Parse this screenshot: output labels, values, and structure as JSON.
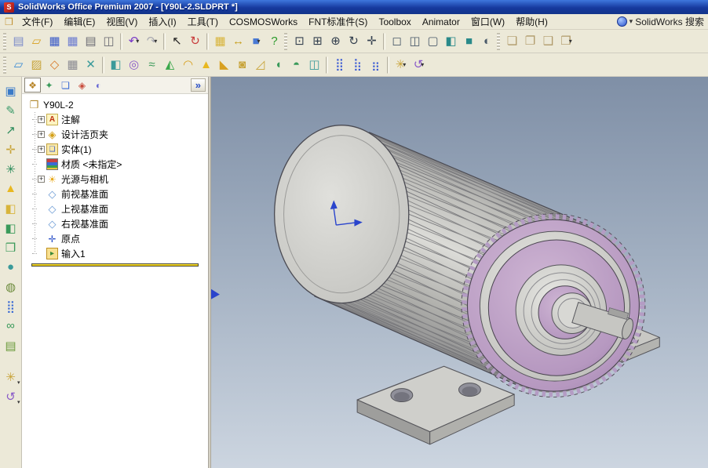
{
  "window": {
    "title": "SolidWorks Office Premium 2007 - [Y90L-2.SLDPRT *]"
  },
  "menubar": {
    "items": [
      {
        "name": "menu-file",
        "label": "文件(F)"
      },
      {
        "name": "menu-edit",
        "label": "编辑(E)"
      },
      {
        "name": "menu-view",
        "label": "视图(V)"
      },
      {
        "name": "menu-insert",
        "label": "插入(I)"
      },
      {
        "name": "menu-tools",
        "label": "工具(T)"
      },
      {
        "name": "menu-cosmosworks",
        "label": "COSMOSWorks"
      },
      {
        "name": "menu-fnt-standard-parts",
        "label": "FNT标准件(S)"
      },
      {
        "name": "menu-toolbox",
        "label": "Toolbox"
      },
      {
        "name": "menu-animator",
        "label": "Animator"
      },
      {
        "name": "menu-window",
        "label": "窗口(W)"
      },
      {
        "name": "menu-help",
        "label": "帮助(H)"
      }
    ],
    "search": {
      "label": "SolidWorks 搜索"
    }
  },
  "toolbar_standard": {
    "icons": [
      {
        "name": "toolbar-grip",
        "cls": "grip"
      },
      {
        "name": "new-file-icon",
        "glyph": "▤",
        "color": "#7a8ac8"
      },
      {
        "name": "open-file-icon",
        "glyph": "▱",
        "color": "#d8a020"
      },
      {
        "name": "save-icon",
        "glyph": "▦",
        "color": "#3a5ac8"
      },
      {
        "name": "save-all-icon",
        "glyph": "▦",
        "color": "#6a7ad0"
      },
      {
        "name": "print-icon",
        "glyph": "▤",
        "color": "#6a6a72"
      },
      {
        "name": "print-preview-icon",
        "glyph": "◫",
        "color": "#6a6a72"
      },
      {
        "name": "toolbar-separator",
        "cls": "sep"
      },
      {
        "name": "undo-icon",
        "glyph": "↶",
        "color": "#7a3ac8",
        "drop": true
      },
      {
        "name": "redo-icon",
        "glyph": "↷",
        "color": "#a8a8b0",
        "drop": true
      },
      {
        "name": "toolbar-separator",
        "cls": "sep"
      },
      {
        "name": "select-cursor-icon",
        "glyph": "↖",
        "color": "#222222"
      },
      {
        "name": "rebuild-icon",
        "glyph": "↻",
        "color": "#c83a3a"
      },
      {
        "name": "toolbar-separator",
        "cls": "sep"
      },
      {
        "name": "sketch-grid-icon",
        "glyph": "▦",
        "color": "#d8b43a"
      },
      {
        "name": "dimension-icon",
        "glyph": "↔",
        "color": "#c8a020"
      },
      {
        "name": "appearance-icon",
        "glyph": "■",
        "color": "#4a7ad4",
        "drop": true
      },
      {
        "name": "help-icon",
        "glyph": "?",
        "color": "#2a9a2a"
      },
      {
        "name": "toolbar-grip",
        "cls": "grip"
      },
      {
        "name": "zoom-to-fit-icon",
        "glyph": "⊡",
        "color": "#333f4e"
      },
      {
        "name": "zoom-area-icon",
        "glyph": "⊞",
        "color": "#333f4e"
      },
      {
        "name": "zoom-in-out-icon",
        "glyph": "⊕",
        "color": "#333f4e"
      },
      {
        "name": "rotate-view-icon",
        "glyph": "↻",
        "color": "#333f4e"
      },
      {
        "name": "pan-icon",
        "glyph": "✛",
        "color": "#333f4e"
      },
      {
        "name": "toolbar-separator",
        "cls": "sep"
      },
      {
        "name": "wireframe-icon",
        "glyph": "◻",
        "color": "#4a5a6a"
      },
      {
        "name": "hidden-lines-visible-icon",
        "glyph": "◫",
        "color": "#4a5a6a"
      },
      {
        "name": "hidden-lines-removed-icon",
        "glyph": "▢",
        "color": "#4a5a6a"
      },
      {
        "name": "shaded-with-edges-icon",
        "glyph": "◧",
        "color": "#2a8a8a"
      },
      {
        "name": "shaded-icon",
        "glyph": "■",
        "color": "#2a8a8a"
      },
      {
        "name": "section-view-icon",
        "glyph": "◐",
        "color": "#4a5a6a"
      },
      {
        "name": "toolbar-grip",
        "cls": "grip"
      },
      {
        "name": "view-orientation-cube-icon",
        "glyph": "❏",
        "color": "#b09a6a"
      },
      {
        "name": "view-cube-front-icon",
        "glyph": "❐",
        "color": "#b09a6a"
      },
      {
        "name": "view-cube-iso-icon",
        "glyph": "❑",
        "color": "#b09a6a"
      },
      {
        "name": "view-cube-dimetric-icon",
        "glyph": "❒",
        "color": "#b09a6a",
        "drop": true
      }
    ]
  },
  "toolbar_features": {
    "icons": [
      {
        "name": "toolbar-grip",
        "cls": "grip"
      },
      {
        "name": "reference-plane-icon",
        "glyph": "▱",
        "color": "#3a8ad4"
      },
      {
        "name": "sketch-tool-icon",
        "glyph": "▨",
        "color": "#c8a43a"
      },
      {
        "name": "convert-entities-icon",
        "glyph": "◇",
        "color": "#d87a2a"
      },
      {
        "name": "grid-icon",
        "glyph": "▦",
        "color": "#8a8a92"
      },
      {
        "name": "trim-icon",
        "glyph": "✕",
        "color": "#3a9a9a"
      },
      {
        "name": "toolbar-separator",
        "cls": "sep"
      },
      {
        "name": "extruded-boss-icon",
        "glyph": "◧",
        "color": "#3a9a9a"
      },
      {
        "name": "revolved-boss-icon",
        "glyph": "◎",
        "color": "#8a5ac8"
      },
      {
        "name": "swept-boss-icon",
        "glyph": "≈",
        "color": "#3a9a5a"
      },
      {
        "name": "lofted-boss-icon",
        "glyph": "◭",
        "color": "#3aa84a"
      },
      {
        "name": "fillet-icon",
        "glyph": "◠",
        "color": "#d8a020"
      },
      {
        "name": "bell-icon",
        "glyph": "▲",
        "color": "#e8b820"
      },
      {
        "name": "chamfer-icon",
        "glyph": "◣",
        "color": "#d8a020"
      },
      {
        "name": "shell-icon",
        "glyph": "◙",
        "color": "#c8a43a"
      },
      {
        "name": "draft-icon",
        "glyph": "◿",
        "color": "#c8a43a"
      },
      {
        "name": "wrap-icon",
        "glyph": "◖",
        "color": "#3a9a5a"
      },
      {
        "name": "dome-icon",
        "glyph": "◓",
        "color": "#3a9a5a"
      },
      {
        "name": "mirror-icon",
        "glyph": "◫",
        "color": "#3a9a9a"
      },
      {
        "name": "toolbar-separator",
        "cls": "sep"
      },
      {
        "name": "linear-pattern-icon",
        "glyph": "⣿",
        "color": "#3a5ad4"
      },
      {
        "name": "circular-pattern-icon",
        "glyph": "⣷",
        "color": "#3a5ad4"
      },
      {
        "name": "table-pattern-icon",
        "glyph": "⣶",
        "color": "#3a5ad4"
      },
      {
        "name": "toolbar-separator",
        "cls": "sep"
      },
      {
        "name": "reference-geometry-icon",
        "glyph": "✳",
        "color": "#c8a43a",
        "drop": true
      },
      {
        "name": "curves-icon",
        "glyph": "↺",
        "color": "#8a5ac8",
        "drop": true
      }
    ]
  },
  "left_toolbar": {
    "icons": [
      {
        "name": "viewport-screen-icon",
        "glyph": "▣",
        "color": "#3a7ac8"
      },
      {
        "name": "pencil-icon",
        "glyph": "✎",
        "color": "#3a9a6a"
      },
      {
        "name": "axis-arrow-icon",
        "glyph": "↗",
        "color": "#2a8a5a"
      },
      {
        "name": "coordinate-icon",
        "glyph": "✛",
        "color": "#c8a43a"
      },
      {
        "name": "note-icon",
        "glyph": "✳",
        "color": "#2a8a5a"
      },
      {
        "name": "bell-icon",
        "glyph": "▲",
        "color": "#e8b820"
      },
      {
        "name": "yellow-box-icon",
        "glyph": "◧",
        "color": "#d8b43a"
      },
      {
        "name": "green-box-icon",
        "glyph": "◧",
        "color": "#3a9a5a"
      },
      {
        "name": "cube-icon",
        "glyph": "❒",
        "color": "#3a9a5a"
      },
      {
        "name": "sphere-icon",
        "glyph": "●",
        "color": "#3a9a9a"
      },
      {
        "name": "disc-icon",
        "glyph": "◍",
        "color": "#6a8a3a"
      },
      {
        "name": "pattern-dots-icon",
        "glyph": "⣿",
        "color": "#3a6ad4"
      },
      {
        "name": "link-icon",
        "glyph": "∞",
        "color": "#3a9a5a"
      },
      {
        "name": "layers-icon",
        "glyph": "▤",
        "color": "#6a9a3a"
      },
      {
        "name": "star-burst-icon",
        "glyph": "✳",
        "color": "#c8a43a",
        "drop": true,
        "cls": "gap"
      },
      {
        "name": "spline-icon",
        "glyph": "↺",
        "color": "#8a5ac8",
        "drop": true
      }
    ]
  },
  "feature_panel": {
    "collapse_label": "»",
    "tabs": [
      {
        "name": "tab-featuremanager",
        "glyph": "❖",
        "color": "#b8862a",
        "cls": "active"
      },
      {
        "name": "tab-propertymanager",
        "glyph": "✦",
        "color": "#3a9a5a"
      },
      {
        "name": "tab-configurationmanager",
        "glyph": "❏",
        "color": "#3a6ad4"
      },
      {
        "name": "tab-cosmosworks",
        "glyph": "◈",
        "color": "#c84a3a"
      },
      {
        "name": "tab-display-pane",
        "glyph": "◐",
        "color": "#6a6ad4"
      }
    ],
    "tree": {
      "root": {
        "label": "Y90L-2"
      },
      "items": [
        {
          "name": "tree-item-annotations",
          "label": "注解",
          "icon": "annotations",
          "expander": "+"
        },
        {
          "name": "tree-item-design-binder",
          "label": "设计活页夹",
          "icon": "design-binder",
          "expander": "+"
        },
        {
          "name": "tree-item-solid-bodies",
          "label": "实体(1)",
          "icon": "solid-bodies",
          "expander": "+"
        },
        {
          "name": "tree-item-material",
          "label": "材质 <未指定>",
          "icon": "material",
          "expander": ""
        },
        {
          "name": "tree-item-lights-cameras",
          "label": "光源与相机",
          "icon": "lights",
          "expander": "+"
        },
        {
          "name": "tree-item-front-plane",
          "label": "前视基准面",
          "icon": "plane",
          "expander": ""
        },
        {
          "name": "tree-item-top-plane",
          "label": "上视基准面",
          "icon": "plane",
          "expander": ""
        },
        {
          "name": "tree-item-right-plane",
          "label": "右视基准面",
          "icon": "plane",
          "expander": ""
        },
        {
          "name": "tree-item-origin",
          "label": "原点",
          "icon": "origin",
          "expander": ""
        },
        {
          "name": "tree-item-imported1",
          "label": "输入1",
          "icon": "imported",
          "expander": ""
        }
      ]
    }
  },
  "colors": {
    "titlebar_start": "#3f77dd",
    "titlebar_end": "#16399e",
    "menubar_bg": "#ece9d8",
    "panel_bg": "#ffffff",
    "viewport_top": "#7f8fa6",
    "viewport_mid": "#a0aec0",
    "viewport_bottom": "#ccd5e0",
    "motor_body": "#c6c6c2",
    "motor_purple": "#b698c0"
  }
}
